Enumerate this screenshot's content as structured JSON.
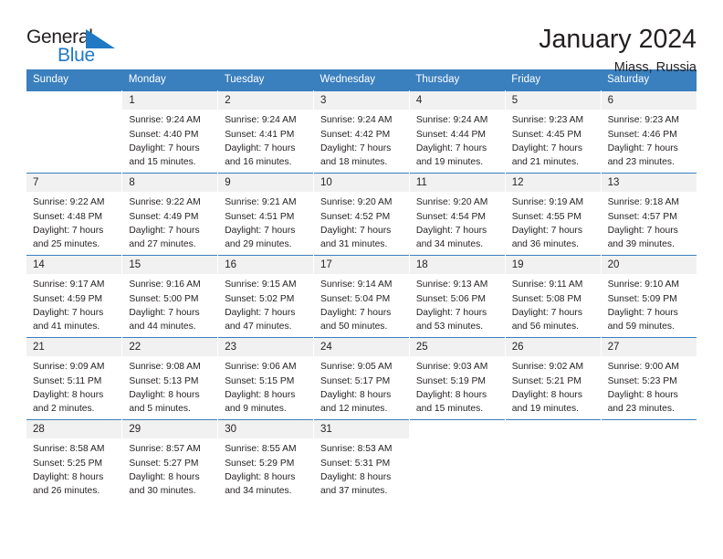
{
  "brand": {
    "name_part1": "General",
    "name_part2": "Blue",
    "flag_icon": "blue-triangle-flag-icon",
    "accent_color": "#2079c3"
  },
  "header": {
    "month_title": "January 2024",
    "location": "Miass, Russia"
  },
  "theme": {
    "header_row_color": "#3a7fbe",
    "daynum_band_color": "#f1f1f1",
    "text_color": "#231f20"
  },
  "calendar": {
    "weekday_headers": [
      "Sunday",
      "Monday",
      "Tuesday",
      "Wednesday",
      "Thursday",
      "Friday",
      "Saturday"
    ],
    "weeks": [
      [
        {
          "day": "",
          "sunrise": "",
          "sunset": "",
          "daylight_line1": "",
          "daylight_line2": ""
        },
        {
          "day": "1",
          "sunrise": "Sunrise: 9:24 AM",
          "sunset": "Sunset: 4:40 PM",
          "daylight_line1": "Daylight: 7 hours",
          "daylight_line2": "and 15 minutes."
        },
        {
          "day": "2",
          "sunrise": "Sunrise: 9:24 AM",
          "sunset": "Sunset: 4:41 PM",
          "daylight_line1": "Daylight: 7 hours",
          "daylight_line2": "and 16 minutes."
        },
        {
          "day": "3",
          "sunrise": "Sunrise: 9:24 AM",
          "sunset": "Sunset: 4:42 PM",
          "daylight_line1": "Daylight: 7 hours",
          "daylight_line2": "and 18 minutes."
        },
        {
          "day": "4",
          "sunrise": "Sunrise: 9:24 AM",
          "sunset": "Sunset: 4:44 PM",
          "daylight_line1": "Daylight: 7 hours",
          "daylight_line2": "and 19 minutes."
        },
        {
          "day": "5",
          "sunrise": "Sunrise: 9:23 AM",
          "sunset": "Sunset: 4:45 PM",
          "daylight_line1": "Daylight: 7 hours",
          "daylight_line2": "and 21 minutes."
        },
        {
          "day": "6",
          "sunrise": "Sunrise: 9:23 AM",
          "sunset": "Sunset: 4:46 PM",
          "daylight_line1": "Daylight: 7 hours",
          "daylight_line2": "and 23 minutes."
        }
      ],
      [
        {
          "day": "7",
          "sunrise": "Sunrise: 9:22 AM",
          "sunset": "Sunset: 4:48 PM",
          "daylight_line1": "Daylight: 7 hours",
          "daylight_line2": "and 25 minutes."
        },
        {
          "day": "8",
          "sunrise": "Sunrise: 9:22 AM",
          "sunset": "Sunset: 4:49 PM",
          "daylight_line1": "Daylight: 7 hours",
          "daylight_line2": "and 27 minutes."
        },
        {
          "day": "9",
          "sunrise": "Sunrise: 9:21 AM",
          "sunset": "Sunset: 4:51 PM",
          "daylight_line1": "Daylight: 7 hours",
          "daylight_line2": "and 29 minutes."
        },
        {
          "day": "10",
          "sunrise": "Sunrise: 9:20 AM",
          "sunset": "Sunset: 4:52 PM",
          "daylight_line1": "Daylight: 7 hours",
          "daylight_line2": "and 31 minutes."
        },
        {
          "day": "11",
          "sunrise": "Sunrise: 9:20 AM",
          "sunset": "Sunset: 4:54 PM",
          "daylight_line1": "Daylight: 7 hours",
          "daylight_line2": "and 34 minutes."
        },
        {
          "day": "12",
          "sunrise": "Sunrise: 9:19 AM",
          "sunset": "Sunset: 4:55 PM",
          "daylight_line1": "Daylight: 7 hours",
          "daylight_line2": "and 36 minutes."
        },
        {
          "day": "13",
          "sunrise": "Sunrise: 9:18 AM",
          "sunset": "Sunset: 4:57 PM",
          "daylight_line1": "Daylight: 7 hours",
          "daylight_line2": "and 39 minutes."
        }
      ],
      [
        {
          "day": "14",
          "sunrise": "Sunrise: 9:17 AM",
          "sunset": "Sunset: 4:59 PM",
          "daylight_line1": "Daylight: 7 hours",
          "daylight_line2": "and 41 minutes."
        },
        {
          "day": "15",
          "sunrise": "Sunrise: 9:16 AM",
          "sunset": "Sunset: 5:00 PM",
          "daylight_line1": "Daylight: 7 hours",
          "daylight_line2": "and 44 minutes."
        },
        {
          "day": "16",
          "sunrise": "Sunrise: 9:15 AM",
          "sunset": "Sunset: 5:02 PM",
          "daylight_line1": "Daylight: 7 hours",
          "daylight_line2": "and 47 minutes."
        },
        {
          "day": "17",
          "sunrise": "Sunrise: 9:14 AM",
          "sunset": "Sunset: 5:04 PM",
          "daylight_line1": "Daylight: 7 hours",
          "daylight_line2": "and 50 minutes."
        },
        {
          "day": "18",
          "sunrise": "Sunrise: 9:13 AM",
          "sunset": "Sunset: 5:06 PM",
          "daylight_line1": "Daylight: 7 hours",
          "daylight_line2": "and 53 minutes."
        },
        {
          "day": "19",
          "sunrise": "Sunrise: 9:11 AM",
          "sunset": "Sunset: 5:08 PM",
          "daylight_line1": "Daylight: 7 hours",
          "daylight_line2": "and 56 minutes."
        },
        {
          "day": "20",
          "sunrise": "Sunrise: 9:10 AM",
          "sunset": "Sunset: 5:09 PM",
          "daylight_line1": "Daylight: 7 hours",
          "daylight_line2": "and 59 minutes."
        }
      ],
      [
        {
          "day": "21",
          "sunrise": "Sunrise: 9:09 AM",
          "sunset": "Sunset: 5:11 PM",
          "daylight_line1": "Daylight: 8 hours",
          "daylight_line2": "and 2 minutes."
        },
        {
          "day": "22",
          "sunrise": "Sunrise: 9:08 AM",
          "sunset": "Sunset: 5:13 PM",
          "daylight_line1": "Daylight: 8 hours",
          "daylight_line2": "and 5 minutes."
        },
        {
          "day": "23",
          "sunrise": "Sunrise: 9:06 AM",
          "sunset": "Sunset: 5:15 PM",
          "daylight_line1": "Daylight: 8 hours",
          "daylight_line2": "and 9 minutes."
        },
        {
          "day": "24",
          "sunrise": "Sunrise: 9:05 AM",
          "sunset": "Sunset: 5:17 PM",
          "daylight_line1": "Daylight: 8 hours",
          "daylight_line2": "and 12 minutes."
        },
        {
          "day": "25",
          "sunrise": "Sunrise: 9:03 AM",
          "sunset": "Sunset: 5:19 PM",
          "daylight_line1": "Daylight: 8 hours",
          "daylight_line2": "and 15 minutes."
        },
        {
          "day": "26",
          "sunrise": "Sunrise: 9:02 AM",
          "sunset": "Sunset: 5:21 PM",
          "daylight_line1": "Daylight: 8 hours",
          "daylight_line2": "and 19 minutes."
        },
        {
          "day": "27",
          "sunrise": "Sunrise: 9:00 AM",
          "sunset": "Sunset: 5:23 PM",
          "daylight_line1": "Daylight: 8 hours",
          "daylight_line2": "and 23 minutes."
        }
      ],
      [
        {
          "day": "28",
          "sunrise": "Sunrise: 8:58 AM",
          "sunset": "Sunset: 5:25 PM",
          "daylight_line1": "Daylight: 8 hours",
          "daylight_line2": "and 26 minutes."
        },
        {
          "day": "29",
          "sunrise": "Sunrise: 8:57 AM",
          "sunset": "Sunset: 5:27 PM",
          "daylight_line1": "Daylight: 8 hours",
          "daylight_line2": "and 30 minutes."
        },
        {
          "day": "30",
          "sunrise": "Sunrise: 8:55 AM",
          "sunset": "Sunset: 5:29 PM",
          "daylight_line1": "Daylight: 8 hours",
          "daylight_line2": "and 34 minutes."
        },
        {
          "day": "31",
          "sunrise": "Sunrise: 8:53 AM",
          "sunset": "Sunset: 5:31 PM",
          "daylight_line1": "Daylight: 8 hours",
          "daylight_line2": "and 37 minutes."
        },
        {
          "day": "",
          "sunrise": "",
          "sunset": "",
          "daylight_line1": "",
          "daylight_line2": ""
        },
        {
          "day": "",
          "sunrise": "",
          "sunset": "",
          "daylight_line1": "",
          "daylight_line2": ""
        },
        {
          "day": "",
          "sunrise": "",
          "sunset": "",
          "daylight_line1": "",
          "daylight_line2": ""
        }
      ]
    ]
  }
}
